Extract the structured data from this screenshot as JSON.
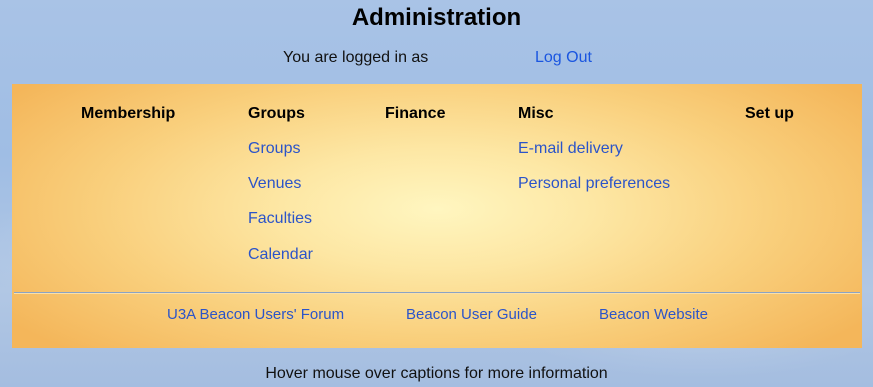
{
  "page": {
    "title": "Administration",
    "login_text": "You are logged in as",
    "logout_label": "Log Out",
    "hint": "Hover mouse over captions for more information"
  },
  "menu": {
    "columns": [
      {
        "heading": "Membership",
        "items": []
      },
      {
        "heading": "Groups",
        "items": [
          "Groups",
          "Venues",
          "Faculties",
          "Calendar"
        ]
      },
      {
        "heading": "Finance",
        "items": []
      },
      {
        "heading": "Misc",
        "items": [
          "E-mail delivery",
          "Personal preferences"
        ]
      },
      {
        "heading": "Set up",
        "items": []
      }
    ]
  },
  "footer": {
    "links": [
      "U3A Beacon Users' Forum",
      "Beacon User Guide",
      "Beacon Website"
    ]
  },
  "colors": {
    "link": "#2b54c9",
    "logout_link": "#1a55e0",
    "panel_center": "#fff6c0",
    "panel_edge": "#f4b65a",
    "background": "#a9c3e6"
  }
}
